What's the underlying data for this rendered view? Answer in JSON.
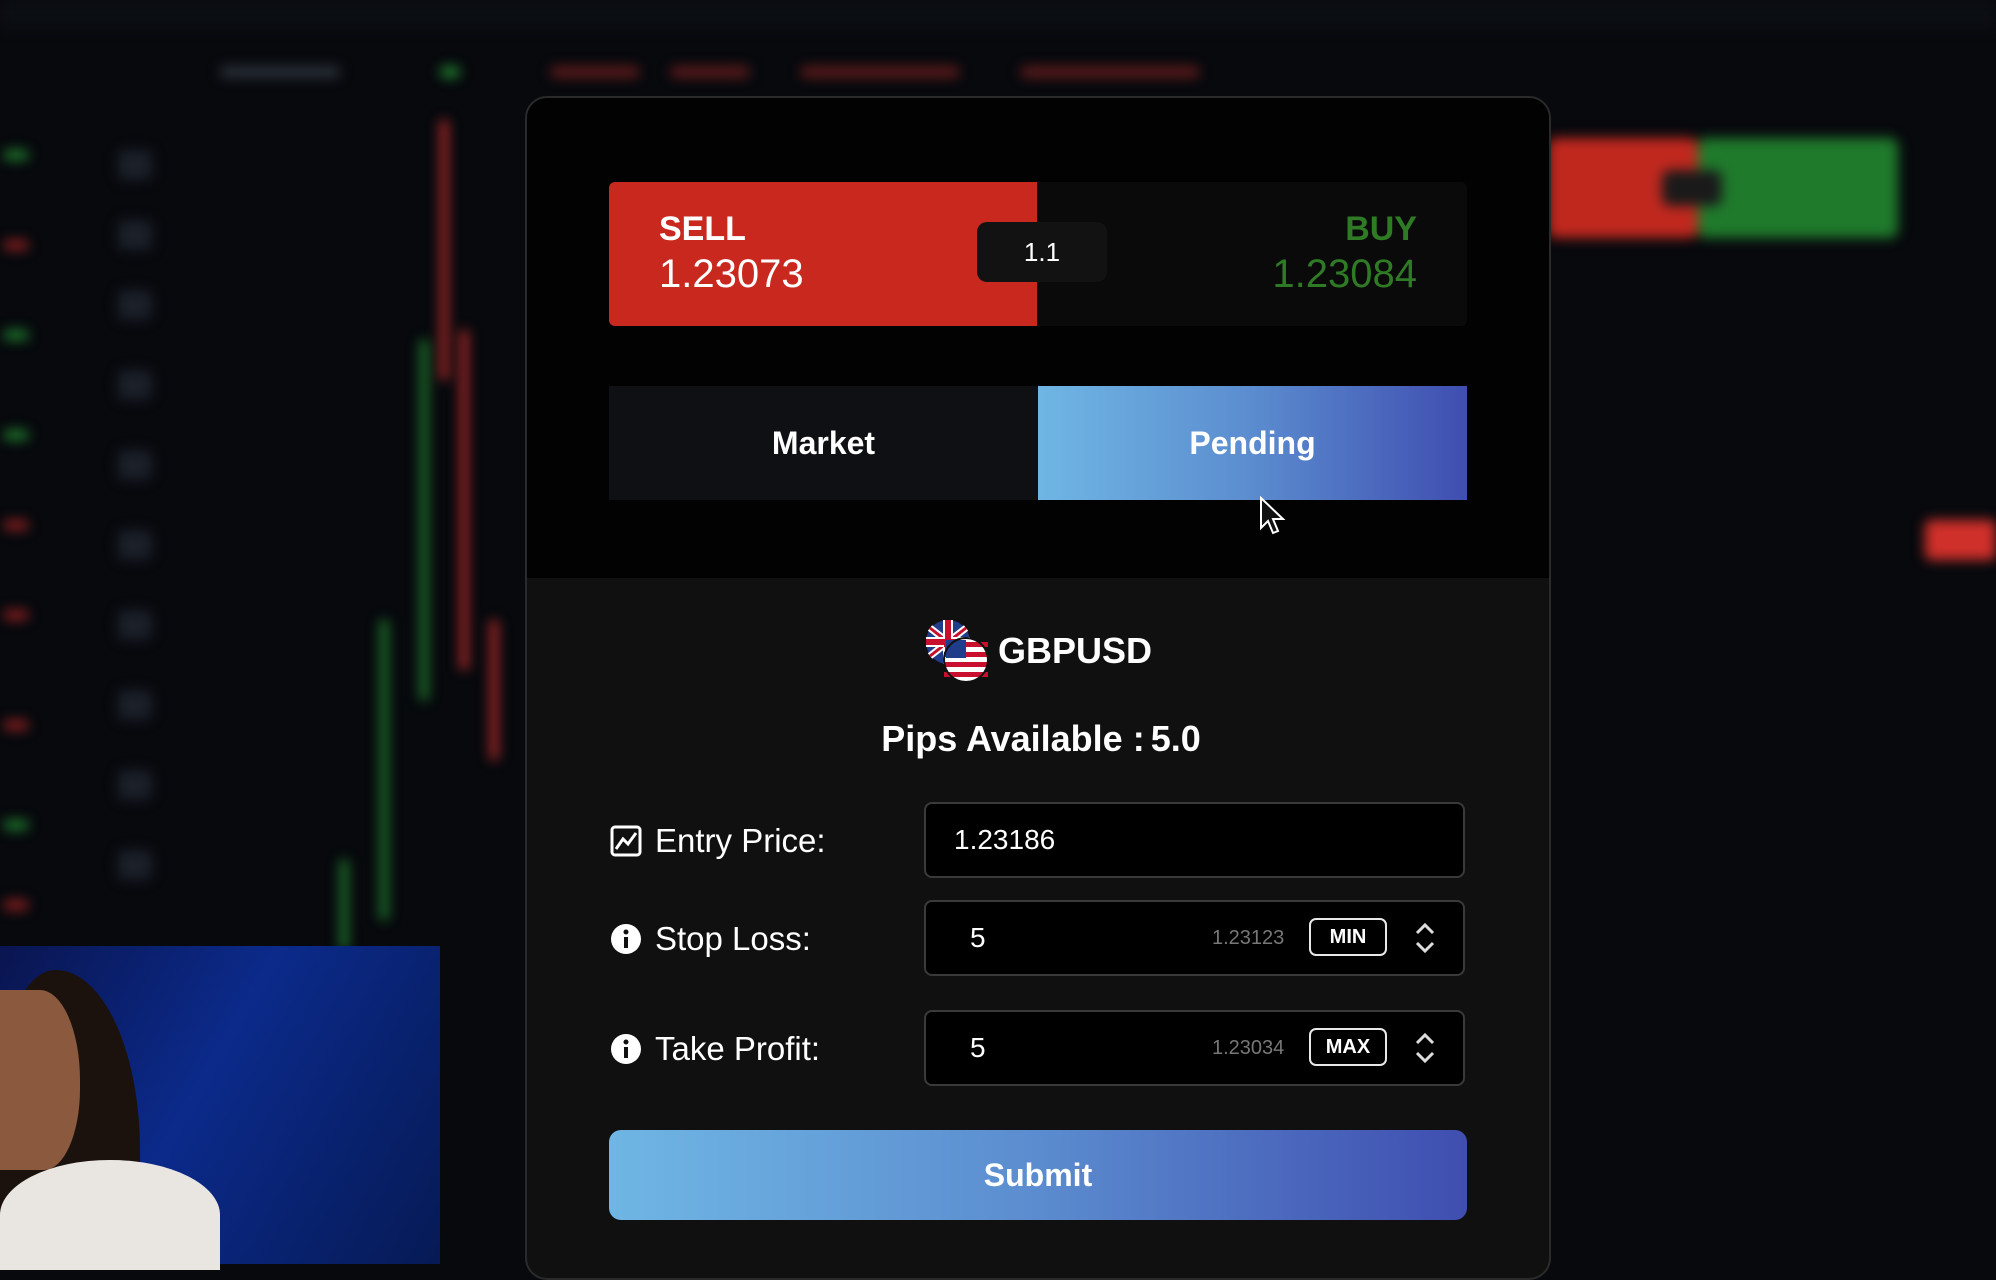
{
  "trade": {
    "sell_label": "SELL",
    "sell_price": "1.23073",
    "spread": "1.1",
    "buy_label": "BUY",
    "buy_price": "1.23084"
  },
  "tabs": [
    {
      "label": "Market",
      "active": false
    },
    {
      "label": "Pending",
      "active": true
    }
  ],
  "symbol": {
    "name": "GBPUSD",
    "flags": [
      "uk-flag-icon",
      "us-flag-icon"
    ]
  },
  "pips": {
    "label": "Pips Available :",
    "value": "5.0"
  },
  "form": {
    "entry_price": {
      "label": "Entry Price:",
      "value": "1.23186",
      "icon": "chart-icon"
    },
    "stop_loss": {
      "label": "Stop Loss:",
      "value": "5",
      "price": "1.23123",
      "tag": "MIN",
      "icon": "info-icon"
    },
    "take_profit": {
      "label": "Take Profit:",
      "value": "5",
      "price": "1.23034",
      "tag": "MAX",
      "icon": "info-icon"
    }
  },
  "submit_label": "Submit",
  "colors": {
    "sell": "#c9281f",
    "buy": "#2f7a25",
    "accent_start": "#6fb6e4",
    "accent_end": "#3f4eb0"
  }
}
